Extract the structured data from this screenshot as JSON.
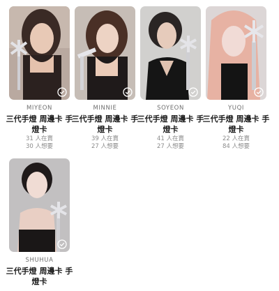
{
  "colors": {
    "check": "#ffffff",
    "title": "#1b1b1b",
    "sub": "#8b8b8b"
  },
  "cards": [
    {
      "member": "MIYEON",
      "title": "三代手燈 周邊卡 手燈卡",
      "have": "31 人在賣",
      "want": "30 人想要",
      "check_icon": "check-circle-icon"
    },
    {
      "member": "MINNIE",
      "title": "三代手燈 周邊卡 手燈卡",
      "have": "39 人在賣",
      "want": "27 人想要",
      "check_icon": "check-circle-icon"
    },
    {
      "member": "SOYEON",
      "title": "三代手燈 周邊卡 手燈卡",
      "have": "41 人在賣",
      "want": "27 人想要",
      "check_icon": "check-circle-icon"
    },
    {
      "member": "YUQI",
      "title": "三代手燈 周邊卡 手燈卡",
      "have": "22 人在賣",
      "want": "84 人想要",
      "check_icon": "check-circle-icon"
    },
    {
      "member": "SHUHUA",
      "title": "三代手燈 周邊卡 手燈卡",
      "have": "",
      "want": "",
      "check_icon": "check-circle-icon"
    }
  ]
}
